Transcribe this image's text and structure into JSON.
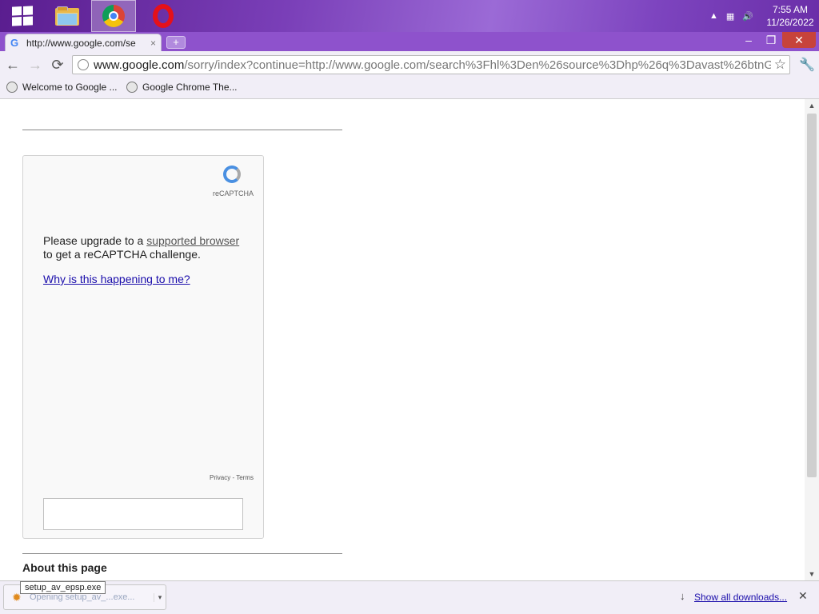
{
  "taskbar": {
    "apps": [
      {
        "name": "start",
        "icon": "windows-logo-icon"
      },
      {
        "name": "file-explorer",
        "icon": "folder-icon"
      },
      {
        "name": "chrome",
        "icon": "chrome-icon"
      },
      {
        "name": "opera",
        "icon": "opera-icon"
      }
    ],
    "tray_icons": [
      "chevron-up-icon",
      "network-icon",
      "volume-icon"
    ],
    "time": "7:55 AM",
    "date": "11/26/2022"
  },
  "browser": {
    "tab_title": "http://www.google.com/se",
    "tab_close": "×",
    "new_tab": "+",
    "window_controls": {
      "minimize": "–",
      "restore": "❐",
      "close": "✕"
    },
    "nav": {
      "back": "←",
      "forward": "→",
      "reload": "⟳"
    },
    "url_host": "www.google.com",
    "url_path": "/sorry/index?continue=http://www.google.com/search%3Fhl%3Den%26source%3Dhp%26q%3Davast%26btnG%",
    "bookmark_star": "☆",
    "menu": "🔧",
    "bookmarks": [
      {
        "label": "Welcome to Google ..."
      },
      {
        "label": "Google Chrome The..."
      }
    ]
  },
  "page": {
    "recaptcha": {
      "logo_label": "reCAPTCHA",
      "message_prefix": "Please upgrade to a ",
      "message_link": "supported browser",
      "message_suffix": " to get a reCAPTCHA challenge.",
      "why_link": "Why is this happening to me?",
      "footer": "Privacy - Terms"
    },
    "about_heading": "About this page"
  },
  "download_shelf": {
    "tooltip": "setup_av_epsp.exe",
    "item_status": "Opening setup_av_...exe...",
    "caret": "▾",
    "show_all": "Show all downloads...",
    "download_icon": "↓",
    "close": "✕"
  }
}
